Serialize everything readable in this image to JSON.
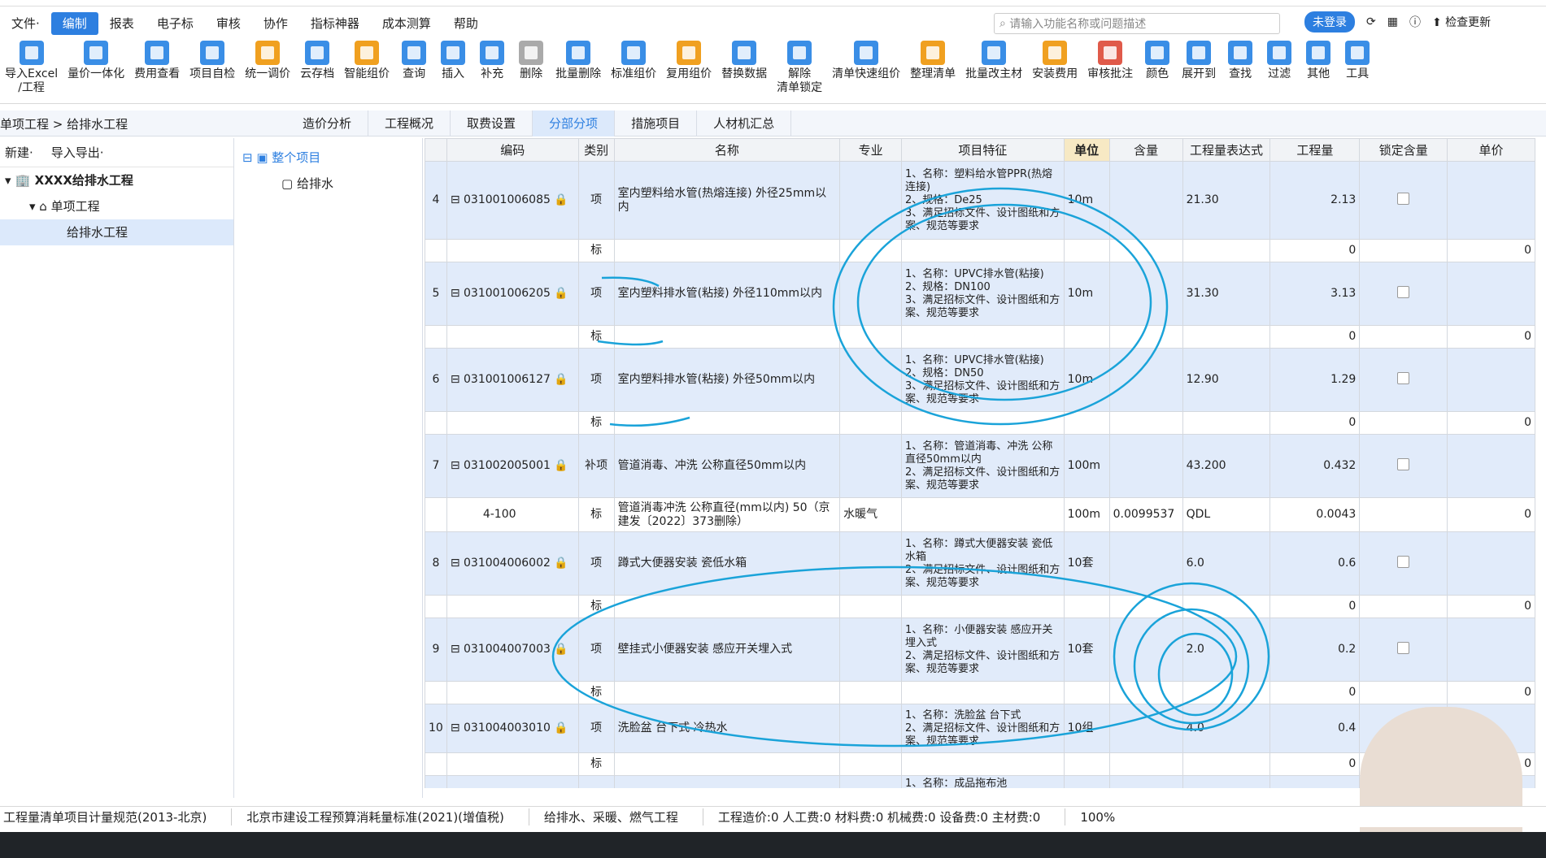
{
  "menu": [
    "文件·",
    "编制",
    "报表",
    "电子标",
    "审核",
    "协作",
    "指标神器",
    "成本测算",
    "帮助"
  ],
  "search_placeholder": "请输入功能名称或问题描述",
  "right": {
    "login": "未登录",
    "update": "检查更新"
  },
  "ribbon": [
    {
      "label": "导入Excel",
      "label2": "/工程",
      "color": "b"
    },
    {
      "label": "量价一体化",
      "color": "b"
    },
    {
      "label": "费用查看",
      "color": "b"
    },
    {
      "label": "项目自检",
      "color": "b"
    },
    {
      "label": "统一调价",
      "color": "o"
    },
    {
      "label": "云存档",
      "color": "b"
    },
    {
      "label": "智能组价",
      "color": "o"
    },
    {
      "label": "查询",
      "color": "b"
    },
    {
      "label": "插入",
      "color": "b"
    },
    {
      "label": "补充",
      "color": "b"
    },
    {
      "label": "删除",
      "color": "g"
    },
    {
      "label": "批量删除",
      "color": "b"
    },
    {
      "label": "标准组价",
      "color": "b"
    },
    {
      "label": "复用组价",
      "color": "o"
    },
    {
      "label": "替换数据",
      "color": "b"
    },
    {
      "label": "解除",
      "label2": "清单锁定",
      "color": "b"
    },
    {
      "label": "清单快速组价",
      "color": "b"
    },
    {
      "label": "整理清单",
      "color": "o"
    },
    {
      "label": "批量改主材",
      "color": "b"
    },
    {
      "label": "安装费用",
      "color": "o"
    },
    {
      "label": "审核批注",
      "color": "r"
    },
    {
      "label": "颜色",
      "color": "b"
    },
    {
      "label": "展开到",
      "color": "b"
    },
    {
      "label": "查找",
      "color": "b"
    },
    {
      "label": "过滤",
      "color": "b"
    },
    {
      "label": "其他",
      "color": "b"
    },
    {
      "label": "工具",
      "color": "b"
    }
  ],
  "breadcrumb": "单项工程 > 给排水工程",
  "tabs": [
    "造价分析",
    "工程概况",
    "取费设置",
    "分部分项",
    "措施项目",
    "人材机汇总"
  ],
  "left": {
    "new": "新建·",
    "io": "导入导出·",
    "tree": [
      "XXXX给排水工程",
      "单项工程",
      "给排水工程"
    ]
  },
  "mid": {
    "tree": [
      "整个项目",
      "给排水"
    ]
  },
  "columns": [
    "编码",
    "类别",
    "名称",
    "专业",
    "项目特征",
    "单位",
    "含量",
    "工程量表达式",
    "工程量",
    "锁定含量",
    "单价"
  ],
  "rows": [
    {
      "type": "item",
      "no": "4",
      "code": "031001006085",
      "cat": "项",
      "name": "室内塑料给水管(热熔连接) 外径25mm以内",
      "feat": "1、名称：塑料给水管PPR(热熔连接)\n2、规格：De25\n3、满足招标文件、设计图纸和方案、规范等要求",
      "unit": "10m",
      "expr": "21.30",
      "qty": "2.13",
      "h": 96
    },
    {
      "type": "sub",
      "cat": "标",
      "qty": "0",
      "price": "0",
      "h": 28
    },
    {
      "type": "item",
      "no": "5",
      "code": "031001006205",
      "cat": "项",
      "name": "室内塑料排水管(粘接) 外径110mm以内",
      "feat": "1、名称：UPVC排水管(粘接)\n2、规格：DN100\n3、满足招标文件、设计图纸和方案、规范等要求",
      "unit": "10m",
      "expr": "31.30",
      "qty": "3.13",
      "h": 78
    },
    {
      "type": "sub",
      "cat": "标",
      "qty": "0",
      "price": "0",
      "h": 28
    },
    {
      "type": "item",
      "no": "6",
      "code": "031001006127",
      "cat": "项",
      "name": "室内塑料排水管(粘接) 外径50mm以内",
      "feat": "1、名称：UPVC排水管(粘接)\n2、规格：DN50\n3、满足招标文件、设计图纸和方案、规范等要求",
      "unit": "10m",
      "expr": "12.90",
      "qty": "1.29",
      "h": 78
    },
    {
      "type": "sub",
      "cat": "标",
      "qty": "0",
      "price": "0",
      "h": 28
    },
    {
      "type": "item",
      "no": "7",
      "code": "031002005001",
      "cat": "补项",
      "name": "管道消毒、冲洗 公称直径50mm以内",
      "feat": "1、名称：管道消毒、冲洗 公称直径50mm以内\n2、满足招标文件、设计图纸和方案、规范等要求",
      "unit": "100m",
      "expr": "43.200",
      "qty": "0.432",
      "h": 78
    },
    {
      "type": "sub",
      "code": "4-100",
      "cat": "标",
      "name": "管道消毒冲洗 公称直径(mm以内) 50（京建发〔2022〕373删除）",
      "spec": "水暖气",
      "unit": "100m",
      "content": "0.0099537",
      "expr": "QDL",
      "qty": "0.0043",
      "price": "0",
      "h": 42
    },
    {
      "type": "item",
      "no": "8",
      "code": "031004006002",
      "cat": "项",
      "name": "蹲式大便器安装 瓷低水箱",
      "feat": "1、名称：蹲式大便器安装 瓷低水箱\n2、满足招标文件、设计图纸和方案、规范等要求",
      "unit": "10套",
      "expr": "6.0",
      "qty": "0.6",
      "h": 78
    },
    {
      "type": "sub",
      "cat": "标",
      "qty": "0",
      "price": "0",
      "h": 28
    },
    {
      "type": "item",
      "no": "9",
      "code": "031004007003",
      "cat": "项",
      "name": "壁挂式小便器安装 感应开关埋入式",
      "feat": "1、名称：小便器安装 感应开关埋入式\n2、满足招标文件、设计图纸和方案、规范等要求",
      "unit": "10套",
      "expr": "2.0",
      "qty": "0.2",
      "h": 78
    },
    {
      "type": "sub",
      "cat": "标",
      "qty": "0",
      "price": "0",
      "h": 28
    },
    {
      "type": "item",
      "no": "10",
      "code": "031004003010",
      "cat": "项",
      "name": "洗脸盆 台下式 冷热水",
      "feat": "1、名称：洗脸盆 台下式\n2、满足招标文件、设计图纸和方案、规范等要求",
      "unit": "10组",
      "expr": "4.0",
      "qty": "0.4",
      "h": 60
    },
    {
      "type": "sub",
      "cat": "标",
      "qty": "0",
      "price": "0",
      "h": 28
    },
    {
      "type": "item",
      "no": "",
      "code": "",
      "cat": "",
      "name": "",
      "feat": "1、名称：成品拖布池",
      "unit": "",
      "expr": "",
      "qty": "",
      "h": 20
    }
  ],
  "status": [
    "工程量清单项目计量规范(2013-北京)",
    "北京市建设工程预算消耗量标准(2021)(增值税)",
    "给排水、采暖、燃气工程",
    "工程造价:0  人工费:0  材料费:0  机械费:0  设备费:0  主材费:0"
  ],
  "zoom": "100%",
  "colors": {
    "accent": "#2d7fe0",
    "annotation": "#1aa3d9"
  }
}
